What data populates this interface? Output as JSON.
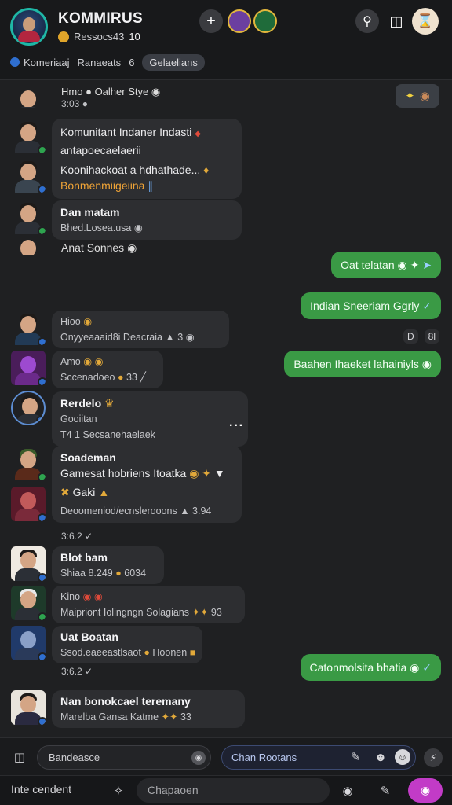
{
  "header": {
    "title": "KOMMIRUS",
    "sub_code": "Ressocs43",
    "sub_count": "10",
    "tabs": [
      "Komeriaaj",
      "Ranaeats",
      "6",
      "Gelaelians"
    ]
  },
  "messages": {
    "m0": {
      "line1": "Hmo",
      "line2": "Oalher Stye",
      "time": "3:03"
    },
    "m1": {
      "line1": "Komunitant Indaner Indasti",
      "line2": "antapoecaelaerii",
      "line3": "Koonihackoat a hdhathade...",
      "line4": "Bonmenmiigeiina"
    },
    "m2": {
      "name": "Dan matam",
      "meta": "Bhed.Losea.usa"
    },
    "m3": {
      "text": "Anat Sonnes"
    },
    "o1": {
      "text": "Oat telatan"
    },
    "o2": {
      "text": "Indian Sneeriam Ggrly"
    },
    "o2_time": [
      "D",
      "8l"
    ],
    "m4": {
      "name": "Hioo",
      "meta": "Onyyeaaaid8i Deacraia",
      "count": "3"
    },
    "m5": {
      "name": "Amo",
      "meta": "Sccenadoeo",
      "count": "33"
    },
    "o3": {
      "text": "Baahen Ihaeket lahainiyls"
    },
    "m6": {
      "name": "Rerdelo",
      "line2": "Gooiitan",
      "meta": "T4 1 Secsanehaelaek"
    },
    "m7": {
      "name": "Soademan",
      "line2": "Gamesat hobriens Itoatka",
      "line3": "Gaki",
      "meta": "Deoomeniod/ecnslerooons",
      "count": "3.94"
    },
    "m7_time": "3:6.2",
    "m8": {
      "name": "Blot bam",
      "meta": "Shiaa 8.249",
      "count": "6034"
    },
    "m9": {
      "name": "Kino",
      "meta": "Maipriont Iolingngn Solagians",
      "count": "93"
    },
    "m10": {
      "name": "Uat Boatan",
      "meta": "Ssod.eaeeastlsaot",
      "count": "Hoonen"
    },
    "m10_time": "3:6.2",
    "o4": {
      "text": "Catonmolsita bhatia"
    },
    "m11": {
      "name": "Nan bonokcael teremany",
      "meta": "Marelba Gansa Katme",
      "count": "33"
    }
  },
  "compose": {
    "input1": "Bandeasce",
    "input2": "Chan Rootans"
  },
  "bottom": {
    "label": "Inte cendent",
    "placeholder": "Chapaoen"
  }
}
